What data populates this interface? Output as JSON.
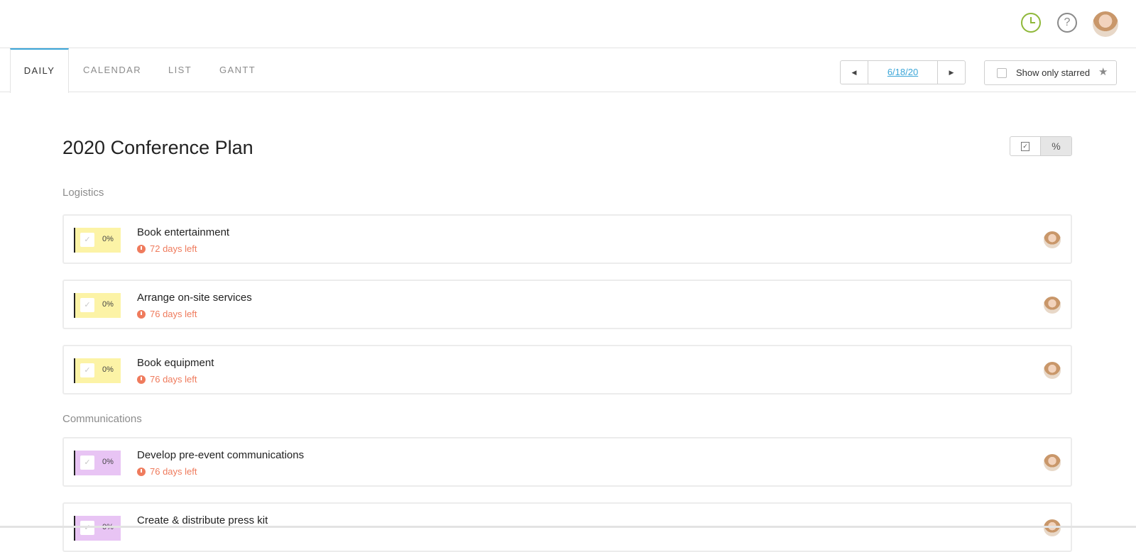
{
  "tabs": [
    "DAILY",
    "CALENDAR",
    "LIST",
    "GANTT"
  ],
  "date_nav": {
    "date": "6/18/20",
    "prev_glyph": "◀",
    "next_glyph": "▶"
  },
  "starred_filter": {
    "label": "Show only starred",
    "checked": false
  },
  "project": {
    "title": "2020 Conference Plan"
  },
  "view_toggle": {
    "check_glyph": "✓",
    "percent_glyph": "%"
  },
  "sections": [
    {
      "label": "Logistics",
      "color": "#fcf3a6",
      "tasks": [
        {
          "name": "Book entertainment",
          "progress": "0%",
          "due": "72 days left"
        },
        {
          "name": "Arrange on-site services",
          "progress": "0%",
          "due": "76 days left"
        },
        {
          "name": "Book equipment",
          "progress": "0%",
          "due": "76 days left"
        }
      ]
    },
    {
      "label": "Communications",
      "color": "#e8c4f4",
      "tasks": [
        {
          "name": "Develop pre-event communications",
          "progress": "0%",
          "due": "76 days left"
        },
        {
          "name": "Create & distribute press kit",
          "progress": "0%",
          "due": ""
        }
      ]
    }
  ],
  "colors": {
    "accent": "#3ba6d8",
    "overdue": "#ef7b5d",
    "clock_icon": "#8fb83a"
  },
  "icons": [
    "clock-icon",
    "help-icon",
    "user-avatar",
    "star-icon",
    "checkbox-icon",
    "percent-icon"
  ]
}
